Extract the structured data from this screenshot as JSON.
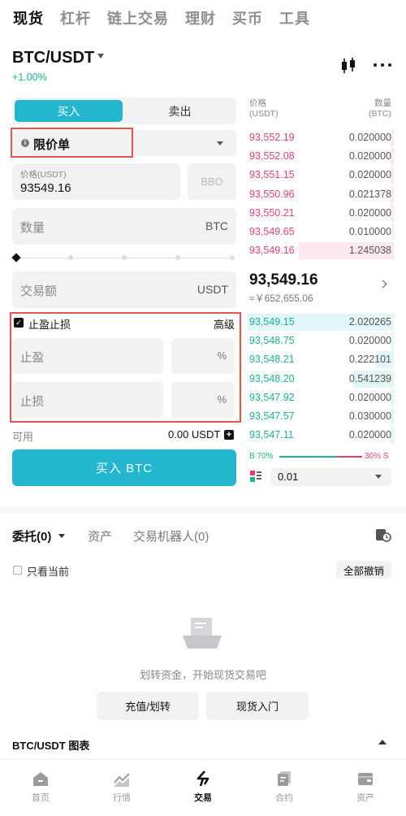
{
  "top_tabs": [
    "现货",
    "杠杆",
    "链上交易",
    "理财",
    "买币",
    "工具"
  ],
  "pair": {
    "symbol": "BTC/USDT",
    "change": "+1.00%"
  },
  "trade_form": {
    "buy_tab": "买入",
    "sell_tab": "卖出",
    "order_type": "限价单",
    "price_label": "价格(USDT)",
    "price_value": "93549.16",
    "bbo": "BBO",
    "qty_label": "数量",
    "qty_unit": "BTC",
    "amount_label": "交易额",
    "amount_unit": "USDT",
    "tpsl_label": "止盈止损",
    "tpsl_advanced": "高级",
    "take_profit": "止盈",
    "stop_loss": "止损",
    "pct": "%",
    "available_label": "可用",
    "available_value": "0.00 USDT",
    "buy_button": "买入 BTC"
  },
  "order_book": {
    "header_price": [
      "价格",
      "(USDT)"
    ],
    "header_qty": [
      "数量",
      "(BTC)"
    ],
    "asks": [
      {
        "price": "93,552.19",
        "qty": "0.020000",
        "depth": 0.02
      },
      {
        "price": "93,552.08",
        "qty": "0.020000",
        "depth": 0.02
      },
      {
        "price": "93,551.15",
        "qty": "0.020000",
        "depth": 0.02
      },
      {
        "price": "93,550.96",
        "qty": "0.021378",
        "depth": 0.02
      },
      {
        "price": "93,550.21",
        "qty": "0.020000",
        "depth": 0.02
      },
      {
        "price": "93,549.65",
        "qty": "0.010000",
        "depth": 0.01
      },
      {
        "price": "93,549.16",
        "qty": "1.245038",
        "depth": 0.65
      }
    ],
    "last_price": "93,549.16",
    "last_price_cny": "≈￥652,655.06",
    "bids": [
      {
        "price": "93,549.15",
        "qty": "2.020265",
        "depth": 1.0
      },
      {
        "price": "93,548.75",
        "qty": "0.020000",
        "depth": 0.02
      },
      {
        "price": "93,548.21",
        "qty": "0.222101",
        "depth": 0.12
      },
      {
        "price": "93,548.20",
        "qty": "0.541239",
        "depth": 0.28
      },
      {
        "price": "93,547.92",
        "qty": "0.020000",
        "depth": 0.02
      },
      {
        "price": "93,547.57",
        "qty": "0.030000",
        "depth": 0.02
      },
      {
        "price": "93,547.11",
        "qty": "0.020000",
        "depth": 0.02
      }
    ],
    "buy_ratio_label": "B 70%",
    "sell_ratio_label": "30% S",
    "buy_ratio": 0.7,
    "depth_precision": "0.01"
  },
  "orders": {
    "tab_orders": "委托(0)",
    "tab_assets": "资产",
    "tab_bots": "交易机器人(0)",
    "only_current": "只看当前",
    "cancel_all": "全部撤销",
    "empty_text": "划转资金，开始现货交易吧",
    "btn_deposit": "充值/划转",
    "btn_guide": "现货入门"
  },
  "chart_bar": {
    "label": "BTC/USDT 图表"
  },
  "bottom_nav": [
    {
      "label": "首页",
      "icon": "home-icon"
    },
    {
      "label": "行情",
      "icon": "market-icon"
    },
    {
      "label": "交易",
      "icon": "trade-icon"
    },
    {
      "label": "合约",
      "icon": "contract-icon"
    },
    {
      "label": "资产",
      "icon": "wallet-icon"
    }
  ],
  "colors": {
    "accent": "#22b6cf",
    "ask": "#e83e6c",
    "bid": "#1ab394",
    "highlight": "#e8534e"
  }
}
